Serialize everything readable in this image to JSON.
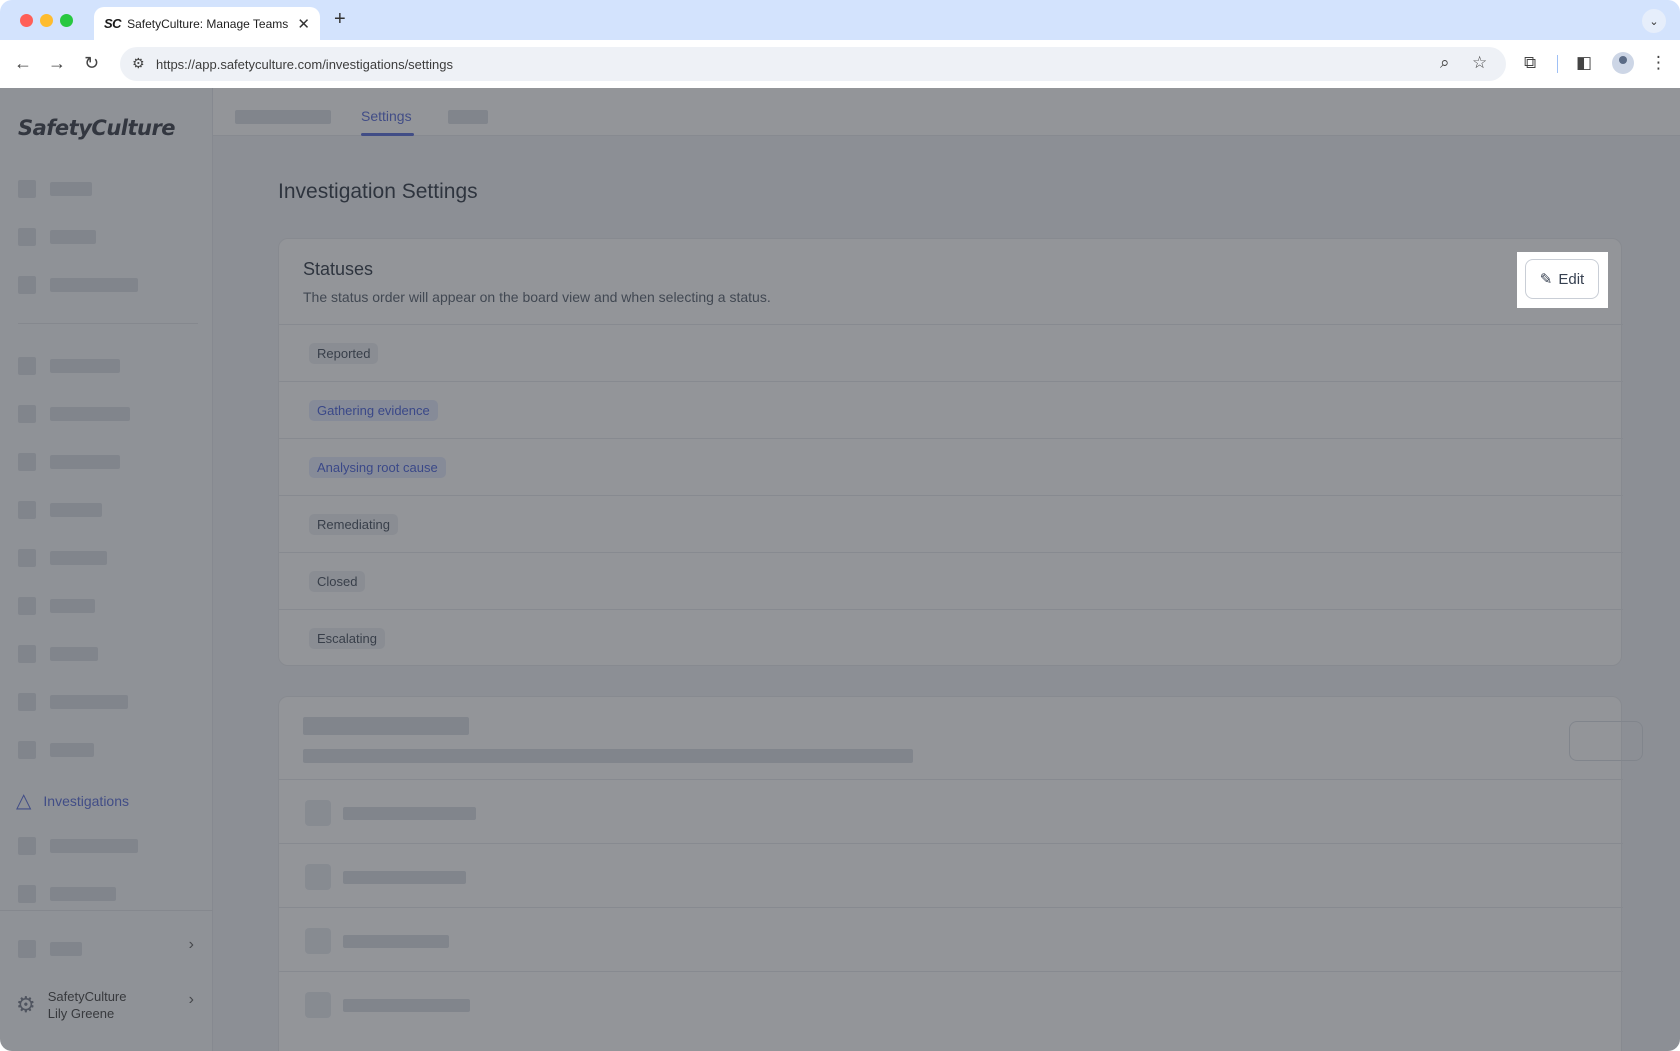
{
  "browser": {
    "tab_favicon": "SC",
    "tab_title": "SafetyCulture: Manage Teams and...",
    "tab_close": "✕",
    "new_tab": "+",
    "url": "https://app.safetyculture.com/investigations/settings"
  },
  "sidebar": {
    "logo": "SafetyCulture",
    "active_item": "Investigations",
    "org_name": "SafetyCulture",
    "user_name": "Lily Greene"
  },
  "topnav": {
    "active_tab": "Settings"
  },
  "page": {
    "title": "Investigation Settings"
  },
  "statuses_card": {
    "title": "Statuses",
    "subtitle": "The status order will appear on the board view and when selecting a status.",
    "edit_label": "Edit",
    "statuses": [
      {
        "label": "Reported",
        "style": "grey"
      },
      {
        "label": "Gathering evidence",
        "style": "blue"
      },
      {
        "label": "Analysing root cause",
        "style": "blue"
      },
      {
        "label": "Remediating",
        "style": "grey"
      },
      {
        "label": "Closed",
        "style": "grey"
      },
      {
        "label": "Escalating",
        "style": "grey"
      }
    ]
  },
  "icons": {
    "back": "←",
    "forward": "→",
    "reload": "↻",
    "zoom": "⌕",
    "star": "☆",
    "extensions": "⧉",
    "sidepanel": "◧",
    "menu": "⋮",
    "pencil": "✎",
    "chevron_right": "›",
    "chevron_down": "⌄",
    "triangle": "△",
    "gear": "⚙"
  },
  "colors": {
    "accent": "#4a5fd6",
    "tabstrip": "#d3e3fd"
  }
}
